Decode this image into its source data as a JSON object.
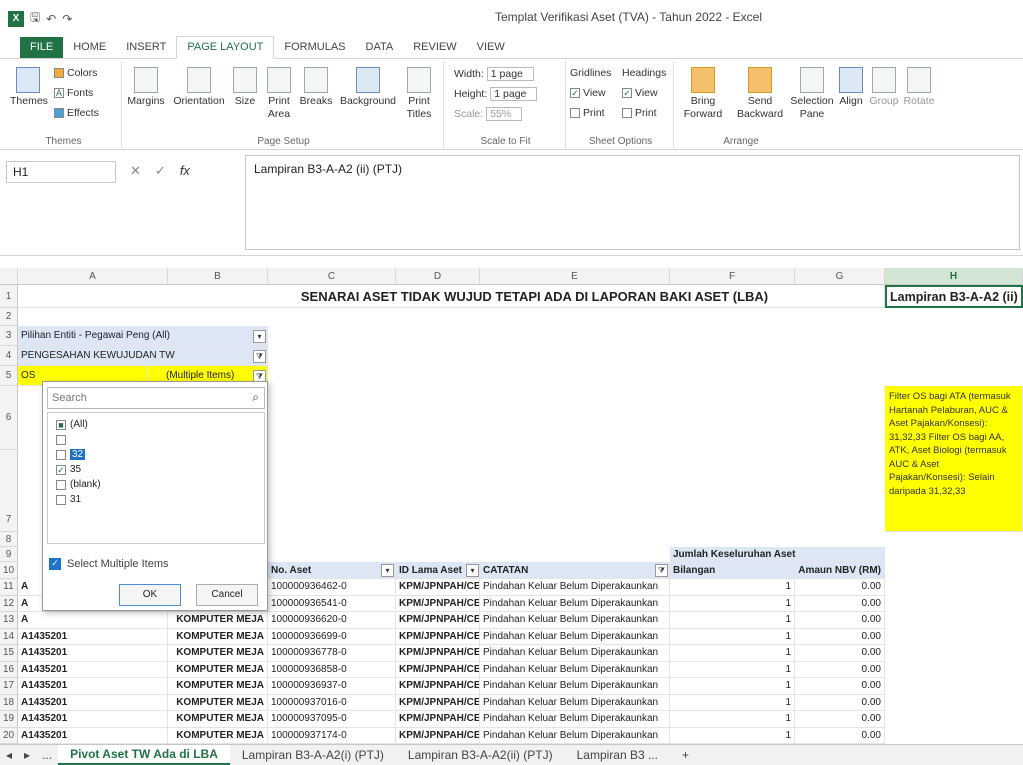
{
  "window": {
    "title": "Templat Verifikasi Aset (TVA) - Tahun 2022 - Excel"
  },
  "ribbon": {
    "tabs": [
      "FILE",
      "HOME",
      "INSERT",
      "PAGE LAYOUT",
      "FORMULAS",
      "DATA",
      "REVIEW",
      "VIEW"
    ],
    "themes": {
      "themes_label": "Themes",
      "colors": "Colors",
      "fonts": "Fonts",
      "effects": "Effects",
      "group": "Themes"
    },
    "page_setup": {
      "margins": "Margins",
      "orientation": "Orientation",
      "size": "Size",
      "print_area": "Print Area",
      "breaks": "Breaks",
      "background": "Background",
      "print_titles": "Print Titles",
      "group": "Page Setup"
    },
    "scale_to_fit": {
      "width_label": "Width:",
      "width_value": "1 page",
      "height_label": "Height:",
      "height_value": "1 page",
      "scale_label": "Scale:",
      "scale_value": "55%",
      "group": "Scale to Fit"
    },
    "sheet_options": {
      "gridlines": "Gridlines",
      "headings": "Headings",
      "view": "View",
      "print": "Print",
      "group": "Sheet Options"
    },
    "arrange": {
      "bring_forward": "Bring Forward",
      "send_backward": "Send Backward",
      "selection_pane": "Selection Pane",
      "align": "Align",
      "group_btn": "Group",
      "rotate": "Rotate",
      "group": "Arrange"
    }
  },
  "formula_bar": {
    "name_box": "H1",
    "formula": "Lampiran B3-A-A2 (ii) (PTJ)"
  },
  "columns": [
    "A",
    "B",
    "C",
    "D",
    "E",
    "F",
    "G",
    "H"
  ],
  "sheet": {
    "title": "SENARAI ASET TIDAK WUJUD TETAPI ADA DI LAPORAN BAKI ASET (LBA)",
    "h1": "Lampiran B3-A-A2 (ii)",
    "filter_entity": "Pilihan Entiti - Pegawai Peng (All)",
    "filter_pengesahan": "PENGESAHAN KEWUJUDAN TW",
    "filter_os_label": "OS",
    "filter_os_value": "(Multiple Items)",
    "note": "Filter OS bagi ATA (termasuk Hartanah Pelaburan, AUC & Aset Pajakan/Konsesi): 31,32,33 Filter OS bagi AA, ATK, Aset Biologi (termasuk AUC & Aset Pajakan/Konsesi): Selain daripada 31,32,33",
    "hdr_jumlah": "Jumlah Keseluruhan Aset",
    "hdr_no_aset": "No. Aset",
    "hdr_id_lama": "ID Lama Aset",
    "hdr_catatan": "CATATAN",
    "hdr_bilangan": "Bilangan",
    "hdr_amaun": "Amaun NBV (RM)",
    "rows": [
      {
        "num": "11",
        "a": "A",
        "c": "100000936462-0",
        "d": "KPM/JPNPAH/CE",
        "e": "Pindahan Keluar Belum Diperakaunkan",
        "f": "1",
        "g": "0.00"
      },
      {
        "num": "12",
        "a": "A",
        "c": "100000936541-0",
        "d": "KPM/JPNPAH/CE",
        "e": "Pindahan Keluar Belum Diperakaunkan",
        "f": "1",
        "g": "0.00"
      },
      {
        "num": "13",
        "a": "A",
        "b": "KOMPUTER MEJA",
        "c": "100000936620-0",
        "d": "KPM/JPNPAH/CE",
        "e": "Pindahan Keluar Belum Diperakaunkan",
        "f": "1",
        "g": "0.00"
      },
      {
        "num": "14",
        "a": "A1435201",
        "b": "KOMPUTER MEJA",
        "c": "100000936699-0",
        "d": "KPM/JPNPAH/CE",
        "e": "Pindahan Keluar Belum Diperakaunkan",
        "f": "1",
        "g": "0.00"
      },
      {
        "num": "15",
        "a": "A1435201",
        "b": "KOMPUTER MEJA",
        "c": "100000936778-0",
        "d": "KPM/JPNPAH/CE",
        "e": "Pindahan Keluar Belum Diperakaunkan",
        "f": "1",
        "g": "0.00"
      },
      {
        "num": "16",
        "a": "A1435201",
        "b": "KOMPUTER MEJA",
        "c": "100000936858-0",
        "d": "KPM/JPNPAH/CE",
        "e": "Pindahan Keluar Belum Diperakaunkan",
        "f": "1",
        "g": "0.00"
      },
      {
        "num": "17",
        "a": "A1435201",
        "b": "KOMPUTER MEJA",
        "c": "100000936937-0",
        "d": "KPM/JPNPAH/CE",
        "e": "Pindahan Keluar Belum Diperakaunkan",
        "f": "1",
        "g": "0.00"
      },
      {
        "num": "18",
        "a": "A1435201",
        "b": "KOMPUTER MEJA",
        "c": "100000937016-0",
        "d": "KPM/JPNPAH/CE",
        "e": "Pindahan Keluar Belum Diperakaunkan",
        "f": "1",
        "g": "0.00"
      },
      {
        "num": "19",
        "a": "A1435201",
        "b": "KOMPUTER MEJA",
        "c": "100000937095-0",
        "d": "KPM/JPNPAH/CE",
        "e": "Pindahan Keluar Belum Diperakaunkan",
        "f": "1",
        "g": "0.00"
      },
      {
        "num": "20",
        "a": "A1435201",
        "b": "KOMPUTER MEJA",
        "c": "100000937174-0",
        "d": "KPM/JPNPAH/CE",
        "e": "Pindahan Keluar Belum Diperakaunkan",
        "f": "1",
        "g": "0.00"
      }
    ]
  },
  "filter_dropdown": {
    "search_placeholder": "Search",
    "items": [
      {
        "label": "(All)",
        "state": "partial"
      },
      {
        "label": "",
        "state": "unchecked"
      },
      {
        "label": "32",
        "state": "unchecked"
      },
      {
        "label": "35",
        "state": "checked"
      },
      {
        "label": "(blank)",
        "state": "unchecked"
      },
      {
        "label": "31",
        "state": "unchecked"
      }
    ],
    "select_multiple": "Select Multiple Items",
    "ok": "OK",
    "cancel": "Cancel"
  },
  "sheet_tabs": {
    "nav_more": "...",
    "tabs": [
      "Pivot Aset TW Ada di LBA",
      "Lampiran B3-A-A2(i) (PTJ)",
      "Lampiran B3-A-A2(ii) (PTJ)",
      "Lampiran B3 ..."
    ],
    "add": "+"
  },
  "colors": {
    "excel_green": "#217346",
    "highlight_yellow": "#ffff00",
    "pivot_blue": "#dce6f5"
  }
}
